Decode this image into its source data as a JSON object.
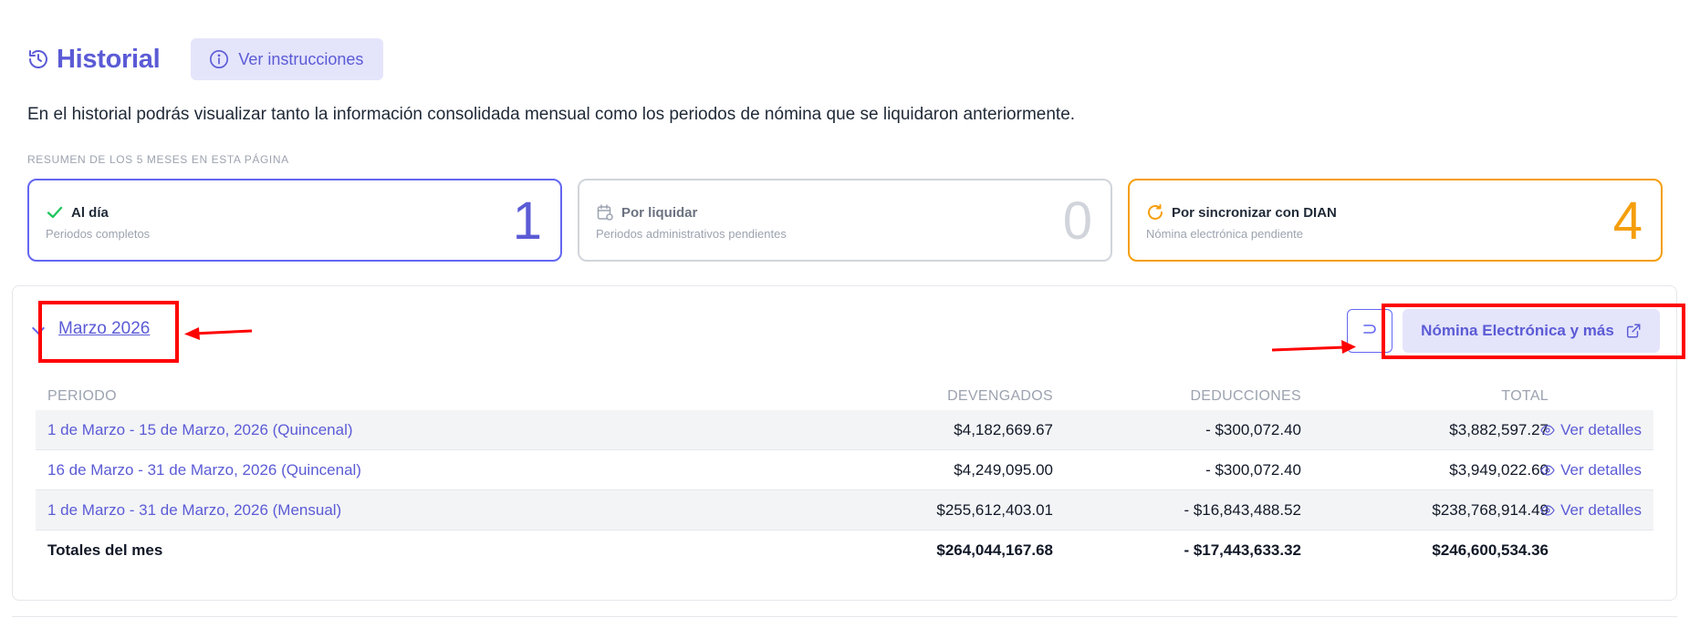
{
  "header": {
    "title": "Historial",
    "instructions_label": "Ver instrucciones"
  },
  "intro_text": "En el historial podrás visualizar tanto la información consolidada mensual como los periodos de nómina que se liquidaron anteriormente.",
  "summary": {
    "caption": "RESUMEN DE LOS 5 MESES EN ESTA PÁGINA",
    "cards": [
      {
        "title": "Al día",
        "subtitle": "Periodos completos",
        "count": "1",
        "color": "#6366f1"
      },
      {
        "title": "Por liquidar",
        "subtitle": "Periodos administrativos pendientes",
        "count": "0",
        "color": "#d1d5db"
      },
      {
        "title": "Por sincronizar con DIAN",
        "subtitle": "Nómina electrónica pendiente",
        "count": "4",
        "color": "#f59e0b"
      }
    ]
  },
  "month": {
    "label": "Marzo 2026",
    "electronic_payroll_label": "Nómina Electrónica y más"
  },
  "table": {
    "headers": {
      "period": "PERIODO",
      "earnings": "DEVENGADOS",
      "deductions": "DEDUCCIONES",
      "total": "TOTAL"
    },
    "rows": [
      {
        "period": "1 de Marzo - 15 de Marzo, 2026 (Quincenal)",
        "earnings": "$4,182,669.67",
        "deductions": "- $300,072.40",
        "total": "$3,882,597.27",
        "action": "Ver detalles"
      },
      {
        "period": "16 de Marzo - 31 de Marzo, 2026 (Quincenal)",
        "earnings": "$4,249,095.00",
        "deductions": "- $300,072.40",
        "total": "$3,949,022.60",
        "action": "Ver detalles"
      },
      {
        "period": "1 de Marzo - 31 de Marzo, 2026 (Mensual)",
        "earnings": "$255,612,403.01",
        "deductions": "- $16,843,488.52",
        "total": "$238,768,914.49",
        "action": "Ver detalles"
      }
    ],
    "totals": {
      "label": "Totales del mes",
      "earnings": "$264,044,167.68",
      "deductions": "- $17,443,633.32",
      "total": "$246,600,534.36"
    }
  },
  "colors": {
    "accent": "#5b5bd6",
    "success": "#22c55e",
    "warning": "#f59e0b",
    "annotation": "#ff0000"
  }
}
